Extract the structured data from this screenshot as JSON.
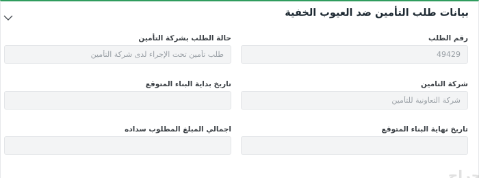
{
  "section": {
    "title": "بيانات طلب التأمين ضد العيوب الخفية",
    "toggle_icon": "chevron-down-icon"
  },
  "fields": {
    "request_number": {
      "label": "رقم الطلب",
      "value": "49429"
    },
    "status_at_insurer": {
      "label": "حالة الطلب بشركة التأمين",
      "value": "طلب تأمين تحت الإجراء لدى شركة التأمين"
    },
    "insurance_company": {
      "label": "شركة التامين",
      "value": "شركة التعاونية للتأمين"
    },
    "expected_construction_start": {
      "label": "تاريخ بداية البناء المتوقع",
      "value": ""
    },
    "expected_construction_end": {
      "label": "تاريخ نهاية البناء المتوقع",
      "value": ""
    },
    "total_amount_due": {
      "label": "اجمالي المبلغ المطلوب سداده",
      "value": ""
    }
  },
  "watermark": {
    "text": "حراج"
  },
  "colors": {
    "accent": "#2f9c5e",
    "field_bg": "#f3f4f5",
    "field_border": "#e3e5e8",
    "label": "#3a3f44",
    "title": "#1e2a33"
  }
}
